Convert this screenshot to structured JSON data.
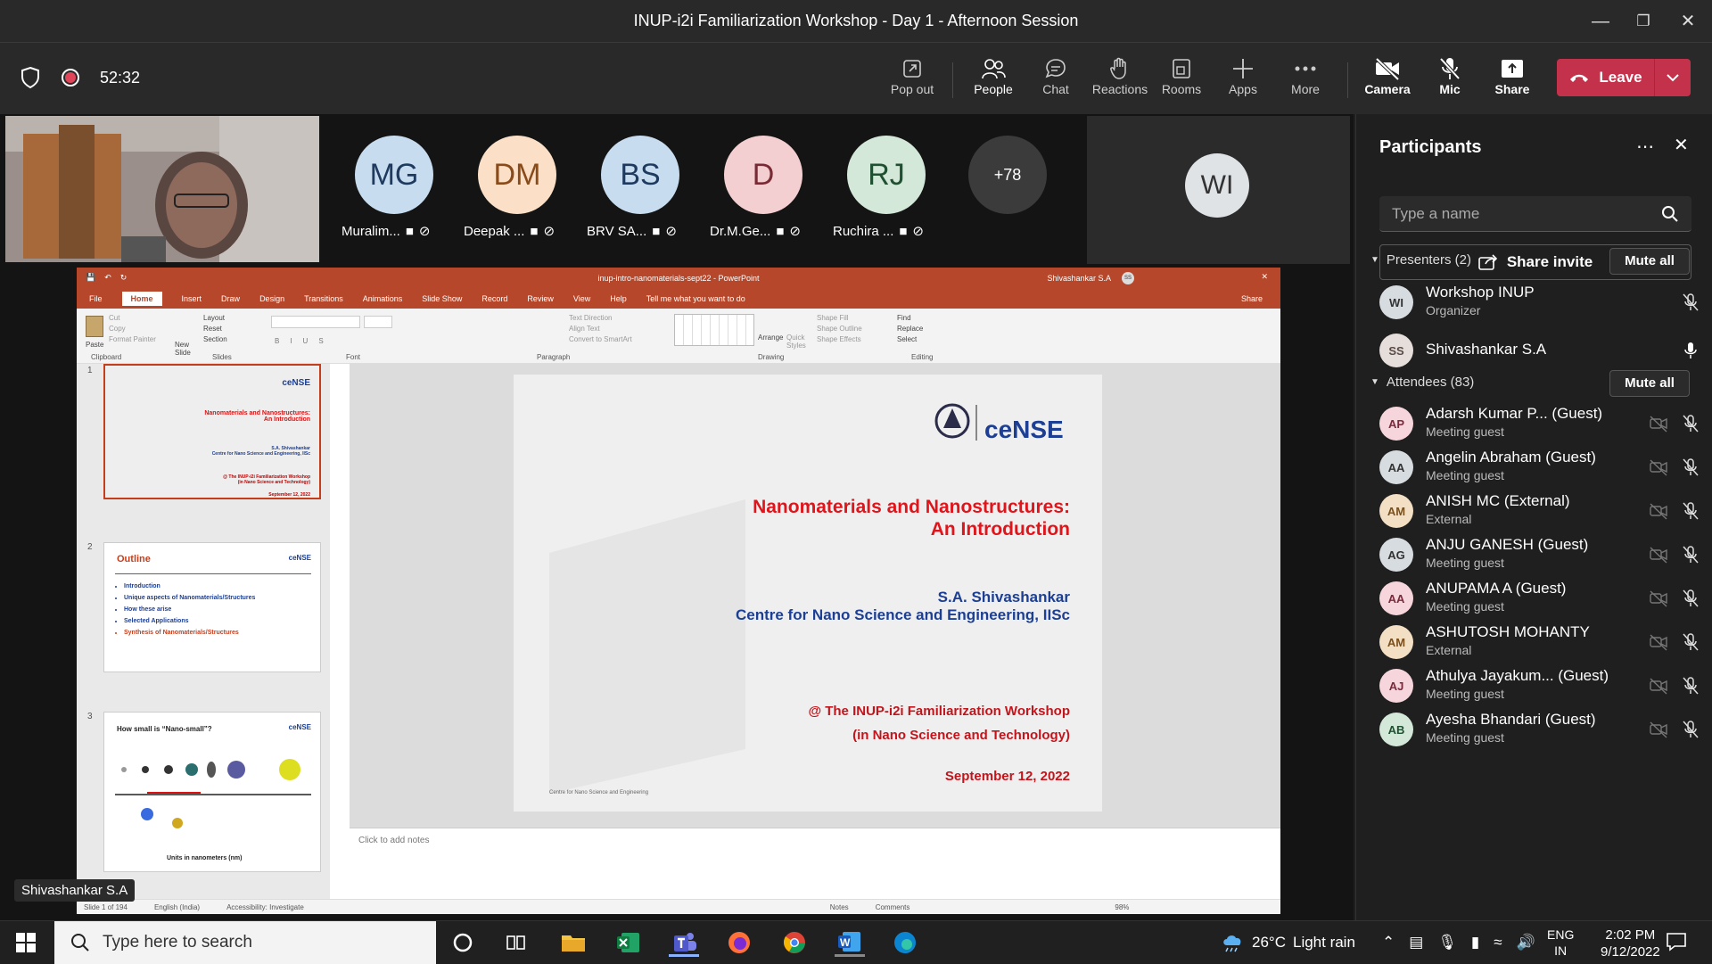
{
  "window": {
    "title": "INUP-i2i Familiarization Workshop - Day 1 - Afternoon Session"
  },
  "meeting": {
    "elapsed": "52:32"
  },
  "toolbar": {
    "popout": "Pop out",
    "people": "People",
    "chat": "Chat",
    "reactions": "Reactions",
    "rooms": "Rooms",
    "apps": "Apps",
    "more": "More",
    "camera": "Camera",
    "mic": "Mic",
    "share": "Share",
    "leave": "Leave"
  },
  "participants_strip": [
    {
      "initials": "MG",
      "name": "Muralim...",
      "bg": "#c7dcef",
      "fg": "#1e3a5f"
    },
    {
      "initials": "DM",
      "name": "Deepak ...",
      "bg": "#fbe0c7",
      "fg": "#8a4b1a"
    },
    {
      "initials": "BS",
      "name": "BRV SA...",
      "bg": "#c7dcef",
      "fg": "#1e3a5f"
    },
    {
      "initials": "D",
      "name": "Dr.M.Ge...",
      "bg": "#f4cfd2",
      "fg": "#7a2a34"
    },
    {
      "initials": "RJ",
      "name": "Ruchira ...",
      "bg": "#d4e8d9",
      "fg": "#1f5031"
    }
  ],
  "overflow_count": "+78",
  "active_tile": {
    "initials": "WI"
  },
  "speaker_label": "Shivashankar S.A",
  "ppt": {
    "file": "inup-intro-nanomaterials-sept22 - PowerPoint",
    "user": "Shivashankar S.A",
    "user_initials": "SS",
    "tabs": [
      "File",
      "Home",
      "Insert",
      "Draw",
      "Design",
      "Transitions",
      "Animations",
      "Slide Show",
      "Record",
      "Review",
      "View",
      "Help"
    ],
    "tell_me": "Tell me what you want to do",
    "share": "Share",
    "groups": [
      "Clipboard",
      "Slides",
      "Font",
      "Paragraph",
      "Drawing",
      "Editing"
    ],
    "ribbon": {
      "paste": "Paste",
      "cut": "Cut",
      "copy": "Copy",
      "format_painter": "Format Painter",
      "new_slide": "New Slide",
      "layout": "Layout",
      "reset": "Reset",
      "section": "Section",
      "find": "Find",
      "replace": "Replace",
      "select": "Select",
      "arrange": "Arrange",
      "quick_styles": "Quick Styles",
      "shape_fill": "Shape Fill",
      "shape_outline": "Shape Outline",
      "shape_effects": "Shape Effects",
      "text_direction": "Text Direction",
      "align_text": "Align Text",
      "convert_smartart": "Convert to SmartArt"
    },
    "slide": {
      "logo_text": "ceNSE",
      "title1": "Nanomaterials and Nanostructures:",
      "title2": "An Introduction",
      "author": "S.A. Shivashankar",
      "affiliation": "Centre for Nano Science and Engineering, IISc",
      "event1": "@ The INUP-i2i Familiarization Workshop",
      "event2": "(in Nano Science and Technology)",
      "date": "September 12, 2022",
      "footer": "Centre for Nano Science and Engineering"
    },
    "thumb2": {
      "title": "Outline",
      "items": [
        "Introduction",
        "Unique aspects of Nanomaterials/Structures",
        "How these arise",
        "Selected Applications",
        "Synthesis of Nanomaterials/Structures"
      ]
    },
    "thumb3": {
      "title": "How small is “Nano-small”?",
      "caption": "Units in nanometers (nm)"
    },
    "thumb_numbers": [
      "1",
      "2",
      "3"
    ],
    "notes_placeholder": "Click to add notes",
    "status": {
      "slide": "Slide 1 of 194",
      "lang": "English (India)",
      "access": "Accessibility: Investigate",
      "notes": "Notes",
      "comments": "Comments",
      "zoom": "98%"
    }
  },
  "panel": {
    "title": "Participants",
    "search_placeholder": "Type a name",
    "invite": "Share invite",
    "presenters_header": "Presenters (2)",
    "attendees_header": "Attendees (83)",
    "mute_all": "Mute all",
    "presenters": [
      {
        "initials": "WI",
        "name": "Workshop INUP",
        "role": "Organizer",
        "bg": "#d7dce0",
        "fg": "#333"
      },
      {
        "initials": "SS",
        "name": "Shivashankar S.A",
        "role": "",
        "bg": "#e6dedb",
        "fg": "#5a4a45"
      }
    ],
    "attendees": [
      {
        "initials": "AP",
        "name": "Adarsh Kumar P...  (Guest)",
        "role": "Meeting guest",
        "bg": "#f6d6dc",
        "fg": "#7a2a3a"
      },
      {
        "initials": "AA",
        "name": "Angelin Abraham (Guest)",
        "role": "Meeting guest",
        "bg": "#d7dce0",
        "fg": "#333"
      },
      {
        "initials": "AM",
        "name": "ANISH MC (External)",
        "role": "External",
        "bg": "#f3dfc4",
        "fg": "#7a4f1a"
      },
      {
        "initials": "AG",
        "name": "ANJU GANESH (Guest)",
        "role": "Meeting guest",
        "bg": "#d7dce0",
        "fg": "#333"
      },
      {
        "initials": "AA",
        "name": "ANUPAMA A (Guest)",
        "role": "Meeting guest",
        "bg": "#f6d6dc",
        "fg": "#7a2a3a"
      },
      {
        "initials": "AM",
        "name": "ASHUTOSH MOHANTY",
        "role": "External",
        "bg": "#f3dfc4",
        "fg": "#7a4f1a"
      },
      {
        "initials": "AJ",
        "name": "Athulya Jayakum... (Guest)",
        "role": "Meeting guest",
        "bg": "#f6d6dc",
        "fg": "#7a2a3a"
      },
      {
        "initials": "AB",
        "name": "Ayesha Bhandari (Guest)",
        "role": "Meeting guest",
        "bg": "#d4e8d9",
        "fg": "#1f5031"
      }
    ]
  },
  "taskbar": {
    "search_placeholder": "Type here to search",
    "weather_temp": "26°C",
    "weather_text": "Light rain",
    "lang1": "ENG",
    "lang2": "IN",
    "time": "2:02 PM",
    "date": "9/12/2022"
  }
}
